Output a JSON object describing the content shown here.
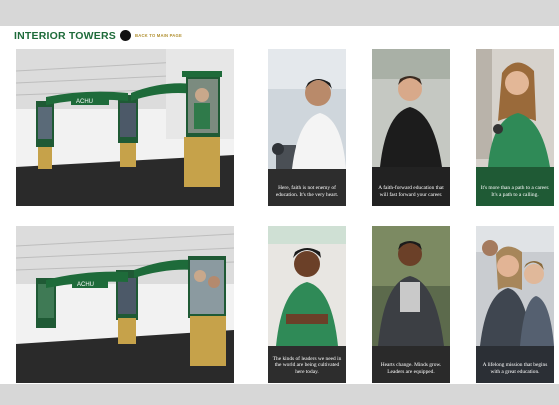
{
  "header": {
    "title": "INTERIOR TOWERS",
    "back_label": "BACK TO MAIN PAGE"
  },
  "renders": [
    {
      "name": "tower-render-1",
      "banner": "ACHU"
    },
    {
      "name": "tower-render-2",
      "banner": "ACHU"
    }
  ],
  "posters": [
    {
      "caption": "Here, faith is not enemy of education. It's the very heart."
    },
    {
      "caption": "A faith-forward education that will fast forward your career."
    },
    {
      "caption": "It's more than a path to a career. It's a path to a calling."
    },
    {
      "caption": "The kinds of leaders we need in the world are being cultivated here today."
    },
    {
      "caption": "Hearts change. Minds grow. Leaders are equipped."
    },
    {
      "caption": "A lifelong mission that begins with a great education."
    }
  ],
  "colors": {
    "brand_green": "#1e6b3a",
    "accent_gold": "#b08f2f",
    "band_gray": "#d7d7d7"
  }
}
